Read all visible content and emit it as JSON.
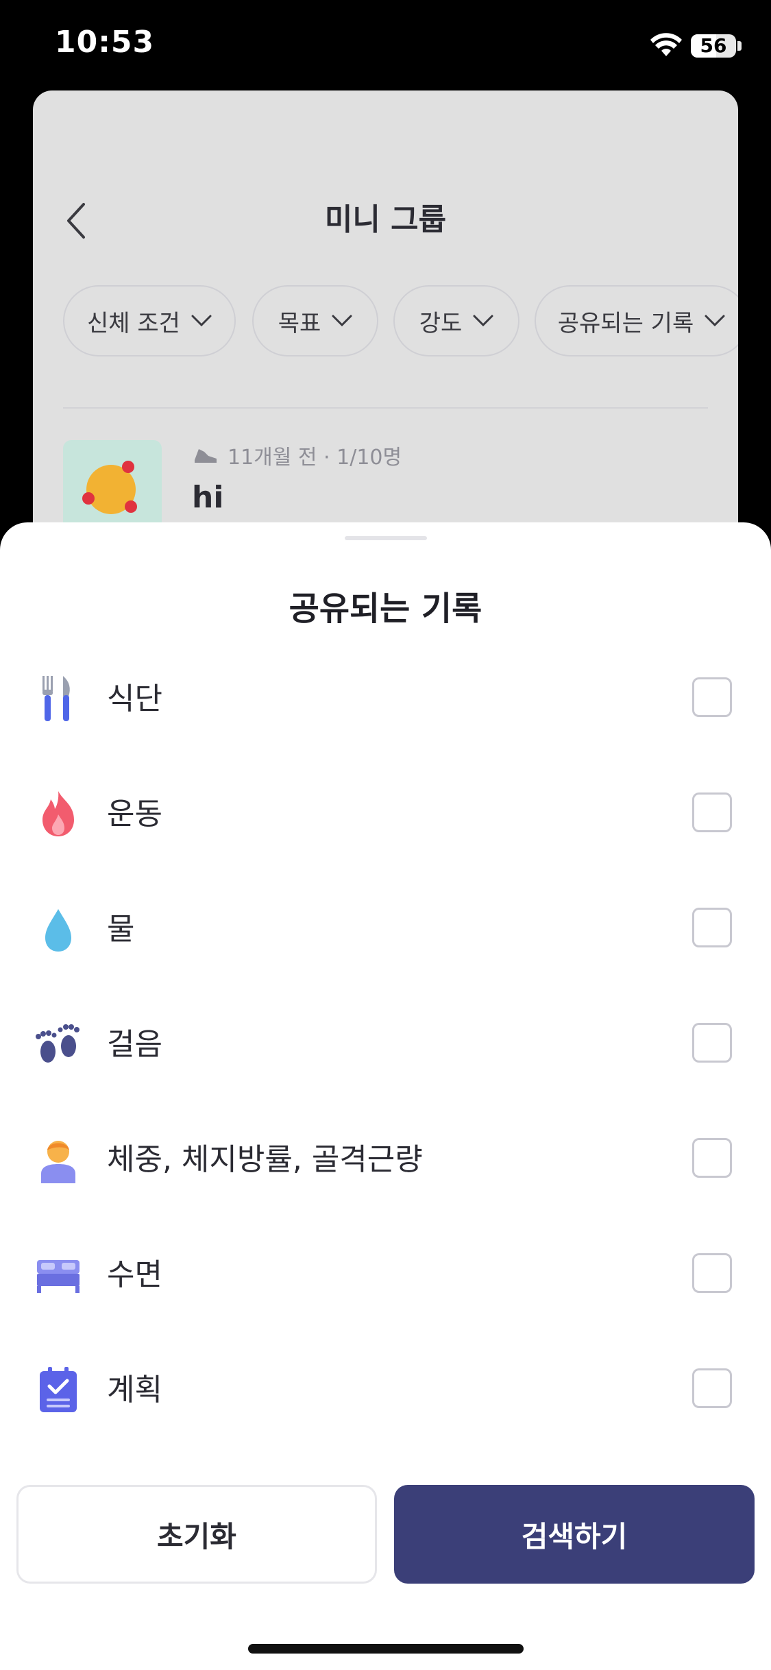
{
  "status": {
    "time": "10:53",
    "battery": "56"
  },
  "header": {
    "title": "미니 그룹"
  },
  "filters": [
    {
      "label": "신체 조건"
    },
    {
      "label": "목표"
    },
    {
      "label": "강도"
    },
    {
      "label": "공유되는 기록"
    }
  ],
  "post": {
    "meta": "11개월 전 · 1/10명",
    "title": "hi"
  },
  "sheet": {
    "title": "공유되는 기록",
    "options": [
      {
        "label": "식단",
        "icon": "fork-knife-icon",
        "checked": false
      },
      {
        "label": "운동",
        "icon": "fire-icon",
        "checked": false
      },
      {
        "label": "물",
        "icon": "water-drop-icon",
        "checked": false
      },
      {
        "label": "걸음",
        "icon": "footprints-icon",
        "checked": false
      },
      {
        "label": "체중, 체지방률, 골격근량",
        "icon": "person-icon",
        "checked": false
      },
      {
        "label": "수면",
        "icon": "bed-icon",
        "checked": false
      },
      {
        "label": "계획",
        "icon": "clipboard-check-icon",
        "checked": false
      }
    ],
    "reset_label": "초기화",
    "search_label": "검색하기"
  },
  "colors": {
    "primary": "#3b3f78",
    "overlay": "#e0e0e0"
  }
}
